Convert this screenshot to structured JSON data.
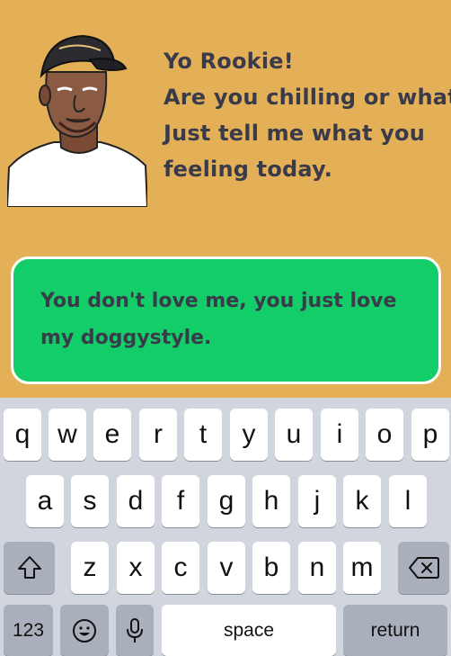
{
  "chat": {
    "greeting_lines": [
      "Yo Rookie!",
      "Are you chilling or what?",
      "Just tell me what you",
      "feeling today."
    ],
    "input_text": "You don't love me, you just love my doggystyle."
  },
  "keyboard": {
    "row1": [
      "q",
      "w",
      "e",
      "r",
      "t",
      "y",
      "u",
      "i",
      "o",
      "p"
    ],
    "row2": [
      "a",
      "s",
      "d",
      "f",
      "g",
      "h",
      "j",
      "k",
      "l"
    ],
    "row3": [
      "z",
      "x",
      "c",
      "v",
      "b",
      "n",
      "m"
    ],
    "numbers_label": "123",
    "space_label": "space",
    "return_label": "return",
    "icons": {
      "shift": "shift-arrow-icon",
      "delete": "backspace-icon",
      "emoji": "emoji-smiley-icon",
      "mic": "microphone-icon"
    }
  },
  "colors": {
    "background": "#e4b057",
    "bubble": "#13cd68",
    "text": "#3a3b4a",
    "keyboard_bg": "#d1d5de",
    "function_key": "#a9b0bc"
  }
}
